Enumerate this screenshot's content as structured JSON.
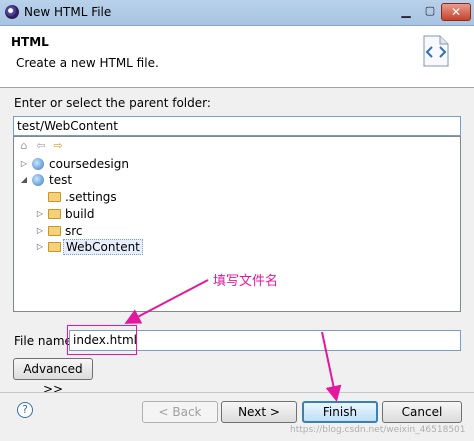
{
  "window": {
    "title": "New HTML File"
  },
  "banner": {
    "title": "HTML",
    "description": "Create a new HTML file."
  },
  "parent": {
    "label": "Enter or select the parent folder:",
    "value": "test/WebContent"
  },
  "tree": {
    "nodes": [
      {
        "label": "coursedesign",
        "expander": "▷",
        "icon": "project-icon"
      },
      {
        "label": "test",
        "expander": "◢",
        "icon": "project-icon"
      },
      {
        "label": ".settings",
        "expander": "",
        "icon": "folder-icon"
      },
      {
        "label": "build",
        "expander": "▷",
        "icon": "folder-icon"
      },
      {
        "label": "src",
        "expander": "▷",
        "icon": "folder-icon"
      },
      {
        "label": "WebContent",
        "expander": "▷",
        "icon": "folder-icon"
      }
    ]
  },
  "annotation": {
    "text": "填写文件名"
  },
  "file": {
    "label": "File name:",
    "value": "index.html"
  },
  "buttons": {
    "advanced": "Advanced >>",
    "back": "< Back",
    "next": "Next >",
    "finish": "Finish",
    "cancel": "Cancel"
  },
  "watermark": "https://blog.csdn.net/weixin_46518501",
  "colors": {
    "annotation": "#e3189e",
    "finish_border": "#3c7fb1"
  }
}
